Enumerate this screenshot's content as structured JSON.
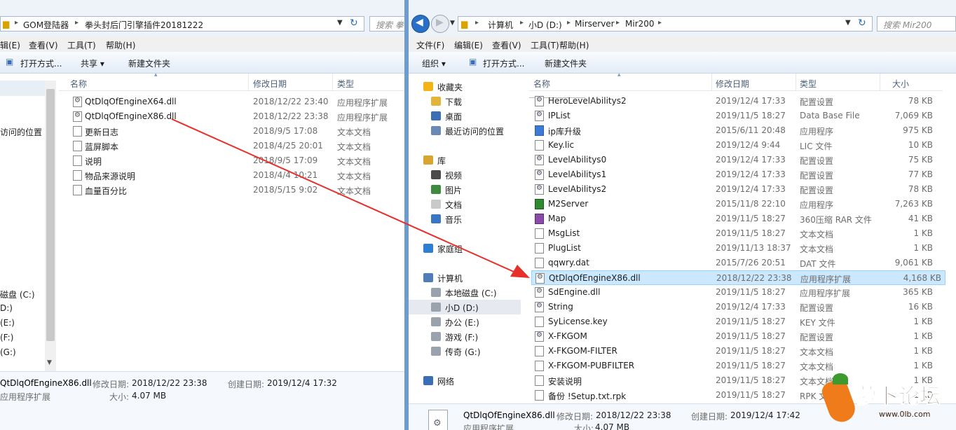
{
  "left": {
    "breadcrumbs": [
      "GOM登陆器",
      "拳头封后门引擎插件20181222"
    ],
    "search_placeholder": "搜索 拳",
    "menu": [
      "辑(E)",
      "查看(V)",
      "工具(T)",
      "帮助(H)"
    ],
    "toolbar": {
      "open": "打开方式...",
      "share": "共享 ▾",
      "new_folder": "新建文件夹"
    },
    "columns": {
      "name": "名称",
      "date": "修改日期",
      "type": "类型"
    },
    "files": [
      {
        "name": "QtDlqOfEngineX64.dll",
        "date": "2018/12/22 23:40",
        "type": "应用程序扩展",
        "icon": "dll"
      },
      {
        "name": "QtDlqOfEngineX86.dll",
        "date": "2018/12/22 23:38",
        "type": "应用程序扩展",
        "icon": "dll"
      },
      {
        "name": "更新日志",
        "date": "2018/9/5 17:08",
        "type": "文本文档",
        "icon": "txt"
      },
      {
        "name": "蓝屏脚本",
        "date": "2018/4/25 20:01",
        "type": "文本文档",
        "icon": "txt"
      },
      {
        "name": "说明",
        "date": "2018/9/5 17:09",
        "type": "文本文档",
        "icon": "txt"
      },
      {
        "name": "物品来源说明",
        "date": "2018/4/4 10:21",
        "type": "文本文档",
        "icon": "txt"
      },
      {
        "name": "血量百分比",
        "date": "2018/5/15 9:02",
        "type": "文本文档",
        "icon": "txt"
      }
    ],
    "nav": [
      "访问的位置",
      "磁盘 (C:)",
      "D:)",
      "(E:)",
      "(F:)",
      "(G:)"
    ],
    "details": {
      "filename": "QtDlqOfEngineX86.dll",
      "filetype": "应用程序扩展",
      "modified_label": "修改日期:",
      "modified": "2018/12/22 23:38",
      "created_label": "创建日期:",
      "created": "2019/12/4 17:32",
      "size_label": "大小:",
      "size": "4.07 MB"
    }
  },
  "right": {
    "breadcrumbs": [
      "计算机",
      "小D (D:)",
      "Mirserver",
      "Mir200"
    ],
    "search_placeholder": "搜索 Mir200",
    "menu": [
      "文件(F)",
      "编辑(E)",
      "查看(V)",
      "工具(T)",
      "帮助(H)"
    ],
    "toolbar": {
      "organize": "组织 ▾",
      "open": "打开方式...",
      "new_folder": "新建文件夹"
    },
    "columns": {
      "name": "名称",
      "date": "修改日期",
      "type": "类型",
      "size": "大小"
    },
    "nav": [
      {
        "label": "收藏夹",
        "indent": 0,
        "icon": "star"
      },
      {
        "label": "下载",
        "indent": 1,
        "icon": "folder"
      },
      {
        "label": "桌面",
        "indent": 1,
        "icon": "desktop"
      },
      {
        "label": "最近访问的位置",
        "indent": 1,
        "icon": "recent"
      },
      {
        "label": "",
        "indent": 0,
        "icon": ""
      },
      {
        "label": "库",
        "indent": 0,
        "icon": "library"
      },
      {
        "label": "视频",
        "indent": 1,
        "icon": "video"
      },
      {
        "label": "图片",
        "indent": 1,
        "icon": "picture"
      },
      {
        "label": "文档",
        "indent": 1,
        "icon": "document"
      },
      {
        "label": "音乐",
        "indent": 1,
        "icon": "music"
      },
      {
        "label": "",
        "indent": 0,
        "icon": ""
      },
      {
        "label": "家庭组",
        "indent": 0,
        "icon": "homegroup"
      },
      {
        "label": "",
        "indent": 0,
        "icon": ""
      },
      {
        "label": "计算机",
        "indent": 0,
        "icon": "computer"
      },
      {
        "label": "本地磁盘 (C:)",
        "indent": 1,
        "icon": "drive"
      },
      {
        "label": "小D (D:)",
        "indent": 1,
        "icon": "drive"
      },
      {
        "label": "办公 (E:)",
        "indent": 1,
        "icon": "drive"
      },
      {
        "label": "游戏 (F:)",
        "indent": 1,
        "icon": "drive"
      },
      {
        "label": "传奇 (G:)",
        "indent": 1,
        "icon": "drive"
      },
      {
        "label": "",
        "indent": 0,
        "icon": ""
      },
      {
        "label": "网络",
        "indent": 0,
        "icon": "network"
      }
    ],
    "files": [
      {
        "name": "HeroLevelAbilitys2",
        "date": "2019/12/4 17:33",
        "type": "配置设置",
        "size": "78 KB",
        "icon": "cfg"
      },
      {
        "name": "IPList",
        "date": "2019/11/5 18:27",
        "type": "Data Base File",
        "size": "7,069 KB",
        "icon": "cfg"
      },
      {
        "name": "ip库升级",
        "date": "2015/6/11 20:48",
        "type": "应用程序",
        "size": "975 KB",
        "icon": "exe"
      },
      {
        "name": "Key.lic",
        "date": "2019/12/4 9:44",
        "type": "LIC 文件",
        "size": "10 KB",
        "icon": "txt"
      },
      {
        "name": "LevelAbilitys0",
        "date": "2019/12/4 17:33",
        "type": "配置设置",
        "size": "75 KB",
        "icon": "cfg"
      },
      {
        "name": "LevelAbilitys1",
        "date": "2019/12/4 17:33",
        "type": "配置设置",
        "size": "77 KB",
        "icon": "cfg"
      },
      {
        "name": "LevelAbilitys2",
        "date": "2019/12/4 17:33",
        "type": "配置设置",
        "size": "78 KB",
        "icon": "cfg"
      },
      {
        "name": "M2Server",
        "date": "2015/11/8 22:10",
        "type": "应用程序",
        "size": "7,263 KB",
        "icon": "m2"
      },
      {
        "name": "Map",
        "date": "2019/11/5 18:27",
        "type": "360压缩 RAR 文件",
        "size": "41 KB",
        "icon": "rar"
      },
      {
        "name": "MsgList",
        "date": "2019/11/5 18:27",
        "type": "文本文档",
        "size": "1 KB",
        "icon": "txt"
      },
      {
        "name": "PlugList",
        "date": "2019/11/13 18:37",
        "type": "文本文档",
        "size": "1 KB",
        "icon": "txt"
      },
      {
        "name": "qqwry.dat",
        "date": "2015/7/26 20:51",
        "type": "DAT 文件",
        "size": "9,061 KB",
        "icon": "txt"
      },
      {
        "name": "QtDlqOfEngineX86.dll",
        "date": "2018/12/22 23:38",
        "type": "应用程序扩展",
        "size": "4,168 KB",
        "icon": "dll"
      },
      {
        "name": "SdEngine.dll",
        "date": "2019/11/5 18:27",
        "type": "应用程序扩展",
        "size": "365 KB",
        "icon": "dll"
      },
      {
        "name": "String",
        "date": "2019/12/4 17:33",
        "type": "配置设置",
        "size": "16 KB",
        "icon": "cfg"
      },
      {
        "name": "SyLicense.key",
        "date": "2019/11/5 18:27",
        "type": "KEY 文件",
        "size": "1 KB",
        "icon": "txt"
      },
      {
        "name": "X-FKGOM",
        "date": "2019/11/5 18:27",
        "type": "配置设置",
        "size": "1 KB",
        "icon": "cfg"
      },
      {
        "name": "X-FKGOM-FILTER",
        "date": "2019/11/5 18:27",
        "type": "文本文档",
        "size": "1 KB",
        "icon": "txt"
      },
      {
        "name": "X-FKGOM-PUBFILTER",
        "date": "2019/11/5 18:27",
        "type": "文本文档",
        "size": "1 KB",
        "icon": "txt"
      },
      {
        "name": "安装说明",
        "date": "2019/11/5 18:27",
        "type": "文本文档",
        "size": "1 KB",
        "icon": "txt"
      },
      {
        "name": "备份 !Setup.txt.rpk",
        "date": "2019/11/5 18:27",
        "type": "RPK 文件",
        "size": "1 KB",
        "icon": "txt"
      }
    ],
    "details": {
      "filename": "QtDlqOfEngineX86.dll",
      "filetype": "应用程序扩展",
      "modified_label": "修改日期:",
      "modified": "2018/12/22 23:38",
      "created_label": "创建日期:",
      "created": "2019/12/4 17:42",
      "size_label": "大小:",
      "size": "4.07 MB"
    }
  },
  "watermark": {
    "text": "萝卜论坛",
    "url": "www.0lb.com"
  },
  "colors": {
    "selection": "#cce8ff",
    "arrow": "#e8302a",
    "accent": "#6e9bd0"
  }
}
